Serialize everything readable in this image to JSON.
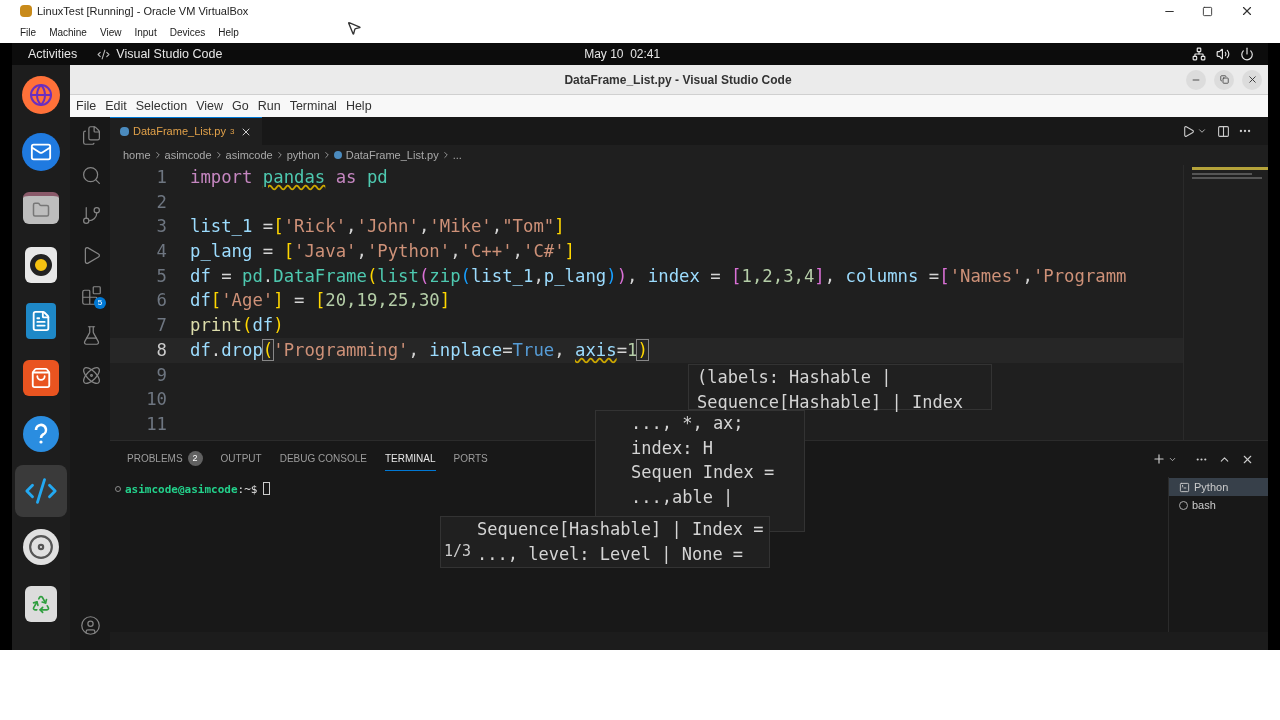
{
  "host_window": {
    "title": "LinuxTest [Running] - Oracle VM VirtualBox",
    "menu": [
      "File",
      "Machine",
      "View",
      "Input",
      "Devices",
      "Help"
    ]
  },
  "top_bar": {
    "activities": "Activities",
    "app_name": "Visual Studio Code",
    "clock": "May 10  02:41"
  },
  "dock": [
    {
      "kind": "browser",
      "selected": false
    },
    {
      "kind": "mail",
      "selected": false
    },
    {
      "kind": "files",
      "selected": false
    },
    {
      "kind": "music",
      "selected": false
    },
    {
      "kind": "writer",
      "selected": false
    },
    {
      "kind": "store",
      "selected": false
    },
    {
      "kind": "help",
      "selected": false
    },
    {
      "kind": "code",
      "selected": true
    },
    {
      "kind": "disc",
      "selected": false
    },
    {
      "kind": "trash",
      "selected": false
    }
  ],
  "editor_window": {
    "title": "DataFrame_List.py - Visual Studio Code",
    "menu": [
      "File",
      "Edit",
      "Selection",
      "View",
      "Go",
      "Run",
      "Terminal",
      "Help"
    ]
  },
  "activity_bar": [
    {
      "kind": "explorer",
      "selected": false
    },
    {
      "kind": "search",
      "selected": false
    },
    {
      "kind": "source_control",
      "selected": false
    },
    {
      "kind": "run",
      "selected": false
    },
    {
      "kind": "extensions",
      "selected": false,
      "badge": "5"
    },
    {
      "kind": "testing",
      "selected": false
    },
    {
      "kind": "atom",
      "selected": false
    }
  ],
  "tabs": [
    {
      "label": "DataFrame_List.py",
      "problems": "3",
      "selected": true
    }
  ],
  "breadcrumb": [
    "home",
    "asimcode",
    "asimcode",
    "python",
    "DataFrame_List.py",
    "..."
  ],
  "code_lines": [
    {
      "number": "1",
      "current": false,
      "tokens": [
        {
          "text": "import ",
          "kind": "keyword"
        },
        {
          "text": "pandas",
          "kind": "module",
          "warning": true
        },
        {
          "text": " as ",
          "kind": "keyword"
        },
        {
          "text": "pd",
          "kind": "module"
        }
      ]
    },
    {
      "number": "2",
      "current": false
    },
    {
      "number": "3",
      "current": false,
      "tokens": [
        {
          "text": "list_1",
          "kind": "variable"
        },
        {
          "text": " =",
          "kind": "plain"
        },
        {
          "text": "[",
          "kind": "bracket1"
        },
        {
          "text": "'Rick'",
          "kind": "string"
        },
        {
          "text": ",",
          "kind": "plain"
        },
        {
          "text": "'John'",
          "kind": "string"
        },
        {
          "text": ",",
          "kind": "plain"
        },
        {
          "text": "'Mike'",
          "kind": "string"
        },
        {
          "text": ",",
          "kind": "plain"
        },
        {
          "text": "\"Tom\"",
          "kind": "string"
        },
        {
          "text": "]",
          "kind": "bracket1"
        }
      ]
    },
    {
      "number": "4",
      "current": false,
      "tokens": [
        {
          "text": "p_lang",
          "kind": "variable"
        },
        {
          "text": " = ",
          "kind": "plain"
        },
        {
          "text": "[",
          "kind": "bracket1"
        },
        {
          "text": "'Java'",
          "kind": "string"
        },
        {
          "text": ",",
          "kind": "plain"
        },
        {
          "text": "'Python'",
          "kind": "string"
        },
        {
          "text": ",",
          "kind": "plain"
        },
        {
          "text": "'C++'",
          "kind": "string"
        },
        {
          "text": ",",
          "kind": "plain"
        },
        {
          "text": "'C#'",
          "kind": "string"
        },
        {
          "text": "]",
          "kind": "bracket1"
        }
      ]
    },
    {
      "number": "5",
      "current": false,
      "tokens": [
        {
          "text": "df",
          "kind": "variable"
        },
        {
          "text": " = ",
          "kind": "plain"
        },
        {
          "text": "pd",
          "kind": "module"
        },
        {
          "text": ".",
          "kind": "plain"
        },
        {
          "text": "DataFrame",
          "kind": "class"
        },
        {
          "text": "(",
          "kind": "bracket1"
        },
        {
          "text": "list",
          "kind": "class"
        },
        {
          "text": "(",
          "kind": "bracket2"
        },
        {
          "text": "zip",
          "kind": "class"
        },
        {
          "text": "(",
          "kind": "bracket3"
        },
        {
          "text": "list_1",
          "kind": "variable"
        },
        {
          "text": ",",
          "kind": "plain"
        },
        {
          "text": "p_lang",
          "kind": "variable"
        },
        {
          "text": ")",
          "kind": "bracket3"
        },
        {
          "text": ")",
          "kind": "bracket2"
        },
        {
          "text": ", ",
          "kind": "plain"
        },
        {
          "text": "index",
          "kind": "variable"
        },
        {
          "text": " = ",
          "kind": "plain"
        },
        {
          "text": "[",
          "kind": "bracket2"
        },
        {
          "text": "1,2,3,4",
          "kind": "number"
        },
        {
          "text": "]",
          "kind": "bracket2"
        },
        {
          "text": ", ",
          "kind": "plain"
        },
        {
          "text": "columns",
          "kind": "variable"
        },
        {
          "text": " =",
          "kind": "plain"
        },
        {
          "text": "[",
          "kind": "bracket2"
        },
        {
          "text": "'Names'",
          "kind": "string"
        },
        {
          "text": ",",
          "kind": "plain"
        },
        {
          "text": "'Programm",
          "kind": "string"
        }
      ]
    },
    {
      "number": "6",
      "current": false,
      "tokens": [
        {
          "text": "df",
          "kind": "variable"
        },
        {
          "text": "[",
          "kind": "bracket1"
        },
        {
          "text": "'Age'",
          "kind": "string"
        },
        {
          "text": "]",
          "kind": "bracket1"
        },
        {
          "text": " = ",
          "kind": "plain"
        },
        {
          "text": "[",
          "kind": "bracket1"
        },
        {
          "text": "20,19,25,30",
          "kind": "number"
        },
        {
          "text": "]",
          "kind": "bracket1"
        }
      ]
    },
    {
      "number": "7",
      "current": false,
      "tokens": [
        {
          "text": "print",
          "kind": "function"
        },
        {
          "text": "(",
          "kind": "bracket1"
        },
        {
          "text": "df",
          "kind": "variable"
        },
        {
          "text": ")",
          "kind": "bracket1"
        }
      ]
    },
    {
      "number": "8",
      "current": true,
      "tokens": [
        {
          "text": "df",
          "kind": "variable"
        },
        {
          "text": ".",
          "kind": "plain"
        },
        {
          "text": "drop",
          "kind": "variable"
        },
        {
          "text": "(",
          "kind": "bracket1",
          "matched": true
        },
        {
          "text": "'Programming'",
          "kind": "string"
        },
        {
          "text": ", ",
          "kind": "plain"
        },
        {
          "text": "inplace",
          "kind": "variable"
        },
        {
          "text": "=",
          "kind": "plain"
        },
        {
          "text": "True",
          "kind": "constant"
        },
        {
          "text": ", ",
          "kind": "plain"
        },
        {
          "text": "axis",
          "kind": "variable",
          "warning": true
        },
        {
          "text": "=",
          "kind": "plain"
        },
        {
          "text": "1",
          "kind": "number"
        },
        {
          "text": ")",
          "kind": "bracket1",
          "matched": true
        }
      ]
    },
    {
      "number": "9",
      "current": false
    },
    {
      "number": "10",
      "current": false
    },
    {
      "number": "11",
      "current": false
    }
  ],
  "hover_fragments": [
    {
      "lines": [
        "(labels: Hashable |",
        "Sequence[Hashable] | Index"
      ]
    },
    {
      "lines": [
        "..., *, ax;",
        "index: H",
        "Sequen Index =",
        "...,able |"
      ]
    },
    {
      "counter": "1/3",
      "lines": [
        "Sequence[Hashable] | Index =",
        "..., level: Level | None ="
      ]
    }
  ],
  "panel": {
    "tabs": [
      {
        "label": "PROBLEMS",
        "badge": "2",
        "selected": false
      },
      {
        "label": "OUTPUT",
        "selected": false
      },
      {
        "label": "DEBUG CONSOLE",
        "selected": false
      },
      {
        "label": "TERMINAL",
        "selected": true
      },
      {
        "label": "PORTS",
        "selected": false
      }
    ],
    "prompt": {
      "user": "asimcode@asimcode",
      "path": ":~$"
    },
    "terminals": [
      {
        "label": "Python",
        "kind": "python",
        "selected": true
      },
      {
        "label": "bash",
        "kind": "bash",
        "selected": false
      }
    ]
  }
}
